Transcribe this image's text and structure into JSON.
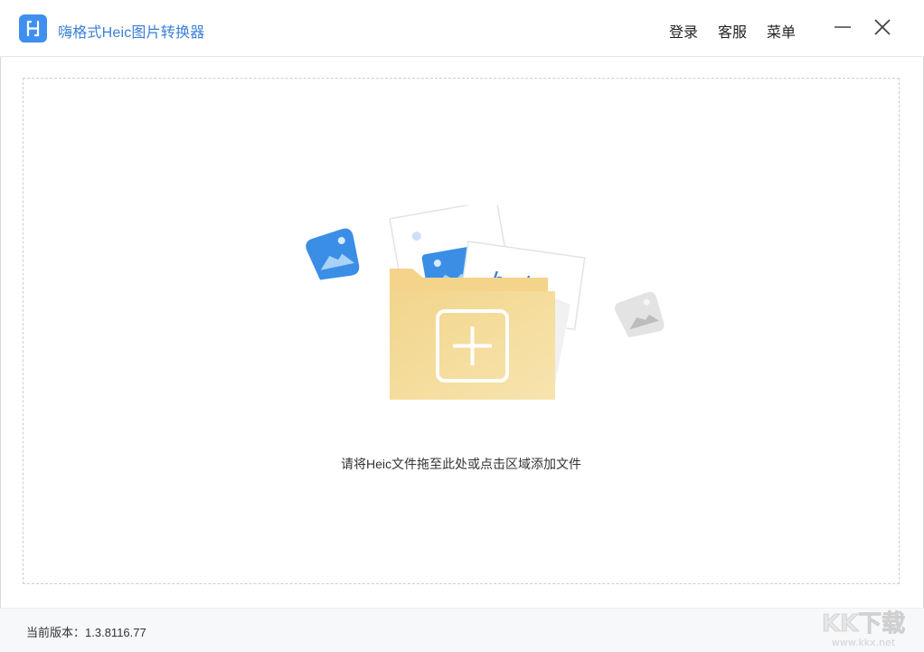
{
  "titlebar": {
    "app_title": "嗨格式Heic图片转换器",
    "nav": {
      "login": "登录",
      "service": "客服",
      "menu": "菜单"
    },
    "icons": {
      "logo": "app-logo-icon",
      "minimize": "minimize-icon",
      "close": "close-icon"
    }
  },
  "dropzone": {
    "hint": "请将Heic文件拖至此处或点击区域添加文件",
    "card_text": "heic",
    "icons": {
      "folder": "add-folder-icon",
      "photo_left": "photo-icon",
      "photo_right": "photo-icon"
    }
  },
  "footer": {
    "version_label": "当前版本：",
    "version_value": "1.3.8116.77"
  },
  "watermark": {
    "text": "KK下载",
    "url": "www.kkx.net"
  },
  "colors": {
    "accent": "#3f8ff0",
    "title_text": "#3a7fd6",
    "folder": "#f4d98b",
    "footer_bg": "#f7f8fa"
  }
}
